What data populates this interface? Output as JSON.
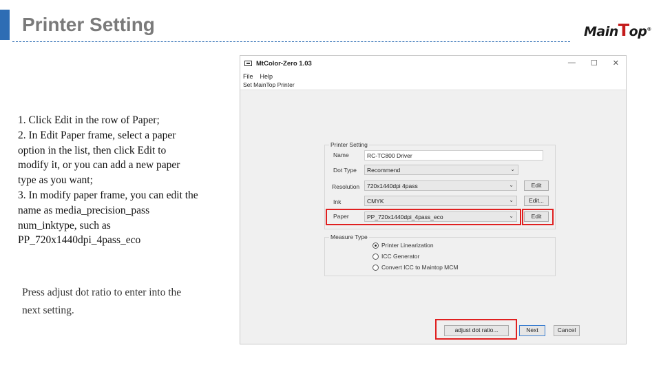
{
  "slide": {
    "title": "Printer Setting",
    "logo_text_1": "Main",
    "logo_text_2": "T",
    "logo_text_3": "op",
    "logo_mark": "®"
  },
  "instructions": [
    "1. Click Edit in the row of Paper;",
    "2. In Edit Paper frame, select a paper option in the list, then click Edit to modify it, or you can add a new paper type as you want;",
    "3. In modify paper frame, you can edit the name as media_precision_pass num_inktype, such as PP_720x1440dpi_4pass_eco"
  ],
  "note": "Press adjust dot ratio to enter into the next setting.",
  "window": {
    "title": "MtColor-Zero 1.03",
    "controls": {
      "minimize": "—",
      "maximize": "☐",
      "close": "✕"
    },
    "menu": [
      "File",
      "Help"
    ],
    "status": "Set MainTop Printer",
    "printer_setting": {
      "legend": "Printer Setting",
      "name_label": "Name",
      "name_value": "RC-TC800 Driver",
      "dot_type_label": "Dot Type",
      "dot_type_value": "Recommend",
      "resolution_label": "Resolution",
      "resolution_value": "720x1440dpi 4pass",
      "ink_label": "Ink",
      "ink_value": "CMYK",
      "paper_label": "Paper",
      "paper_value": "PP_720x1440dpi_4pass_eco",
      "edit_label": "Edit",
      "edit_ink_label": "Edit..."
    },
    "measure_type": {
      "legend": "Measure Type",
      "options": [
        "Printer Linearization",
        "ICC Generator",
        "Convert ICC to Maintop MCM"
      ],
      "selected_index": 0
    },
    "buttons": {
      "adjust": "adjust dot ratio...",
      "next": "Next",
      "cancel": "Cancel"
    },
    "colors": {
      "highlight": "#e02020",
      "accent": "#2e6db4"
    }
  }
}
